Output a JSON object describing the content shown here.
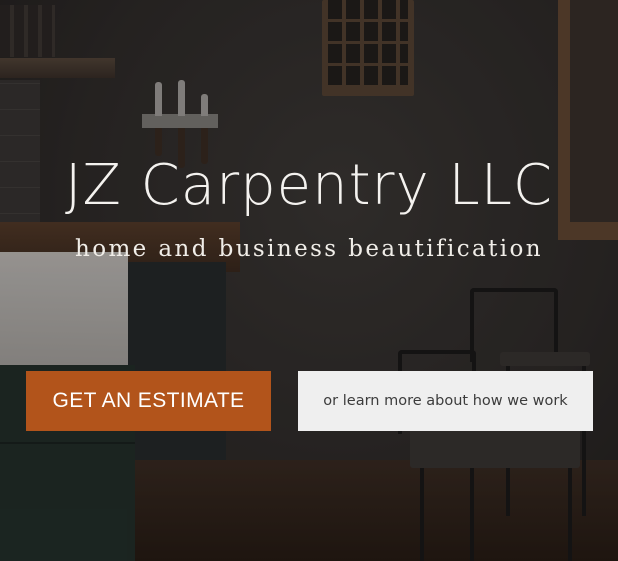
{
  "hero": {
    "title": "JZ Carpentry LLC",
    "tagline": "home and business beautification",
    "background": "dark-kitchen-photo"
  },
  "actions": {
    "estimate_label": "GET AN ESTIMATE",
    "learn_label": "or learn more about how we work"
  },
  "colors": {
    "accent": "#b2541b",
    "secondary_button_bg": "#efefef",
    "title_text": "#f4f2ef"
  }
}
